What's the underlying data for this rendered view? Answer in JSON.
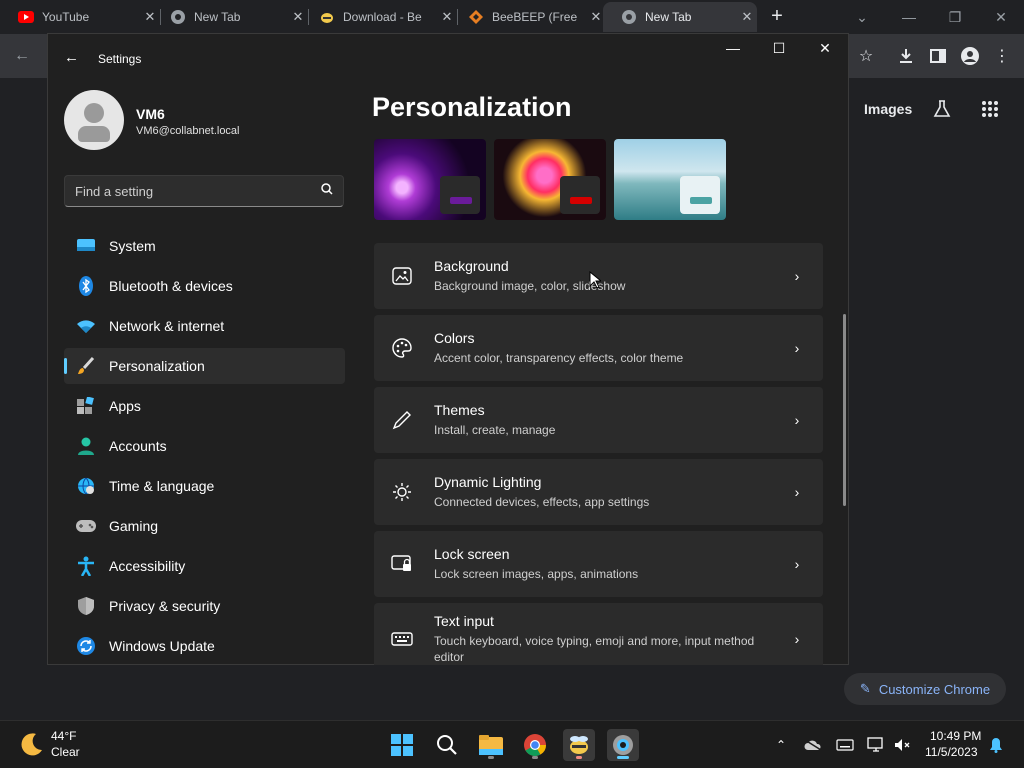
{
  "browser": {
    "tabs": [
      {
        "title": "YouTube",
        "favicon": "youtube-icon"
      },
      {
        "title": "New Tab",
        "favicon": "chrome-icon"
      },
      {
        "title": "Download - Be",
        "favicon": "beebeep-icon"
      },
      {
        "title": "BeeBEEP (Free",
        "favicon": "beebeep-diamond-icon"
      },
      {
        "title": "New Tab",
        "favicon": "chrome-icon"
      }
    ],
    "page_links": {
      "images": "Images"
    },
    "customize_label": "Customize Chrome"
  },
  "settings": {
    "window_title": "Settings",
    "user": {
      "name": "VM6",
      "email": "VM6@collabnet.local"
    },
    "search_placeholder": "Find a setting",
    "nav": [
      {
        "label": "System",
        "icon": "system-icon"
      },
      {
        "label": "Bluetooth & devices",
        "icon": "bluetooth-icon"
      },
      {
        "label": "Network & internet",
        "icon": "wifi-icon"
      },
      {
        "label": "Personalization",
        "icon": "brush-icon",
        "selected": true
      },
      {
        "label": "Apps",
        "icon": "apps-icon"
      },
      {
        "label": "Accounts",
        "icon": "accounts-icon"
      },
      {
        "label": "Time & language",
        "icon": "globe-clock-icon"
      },
      {
        "label": "Gaming",
        "icon": "gamepad-icon"
      },
      {
        "label": "Accessibility",
        "icon": "accessibility-icon"
      },
      {
        "label": "Privacy & security",
        "icon": "shield-icon"
      },
      {
        "label": "Windows Update",
        "icon": "update-icon"
      }
    ],
    "page_title": "Personalization",
    "theme_accents": [
      "#6a1b9a",
      "#d50000",
      "#4aa3a3"
    ],
    "cards": [
      {
        "title": "Background",
        "subtitle": "Background image, color, slideshow",
        "icon": "image-icon"
      },
      {
        "title": "Colors",
        "subtitle": "Accent color, transparency effects, color theme",
        "icon": "palette-icon"
      },
      {
        "title": "Themes",
        "subtitle": "Install, create, manage",
        "icon": "pen-icon"
      },
      {
        "title": "Dynamic Lighting",
        "subtitle": "Connected devices, effects, app settings",
        "icon": "sun-icon"
      },
      {
        "title": "Lock screen",
        "subtitle": "Lock screen images, apps, animations",
        "icon": "lock-screen-icon"
      },
      {
        "title": "Text input",
        "subtitle": "Touch keyboard, voice typing, emoji and more, input method editor",
        "icon": "keyboard-icon"
      }
    ]
  },
  "taskbar": {
    "weather": {
      "temp": "44°F",
      "condition": "Clear"
    },
    "clock": {
      "time": "10:49 PM",
      "date": "11/5/2023"
    }
  }
}
